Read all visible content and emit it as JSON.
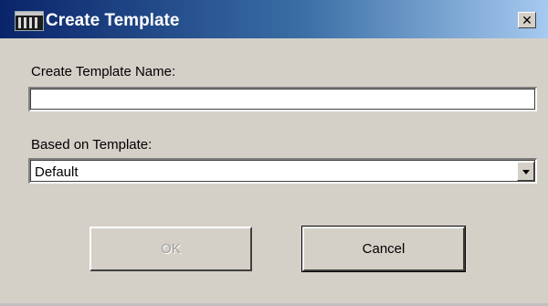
{
  "window": {
    "title": "Create Template",
    "close_glyph": "✕",
    "icon": "app-icon"
  },
  "form": {
    "name_label": "Create Template Name:",
    "name_value": "",
    "name_placeholder": "",
    "based_label": "Based on Template:",
    "based_value": "Default"
  },
  "buttons": {
    "ok_label": "OK",
    "ok_enabled": false,
    "cancel_label": "Cancel"
  },
  "colors": {
    "titlebar_start": "#0a246a",
    "titlebar_end": "#a6caf0",
    "dialog_bg": "#d4d0c8"
  }
}
